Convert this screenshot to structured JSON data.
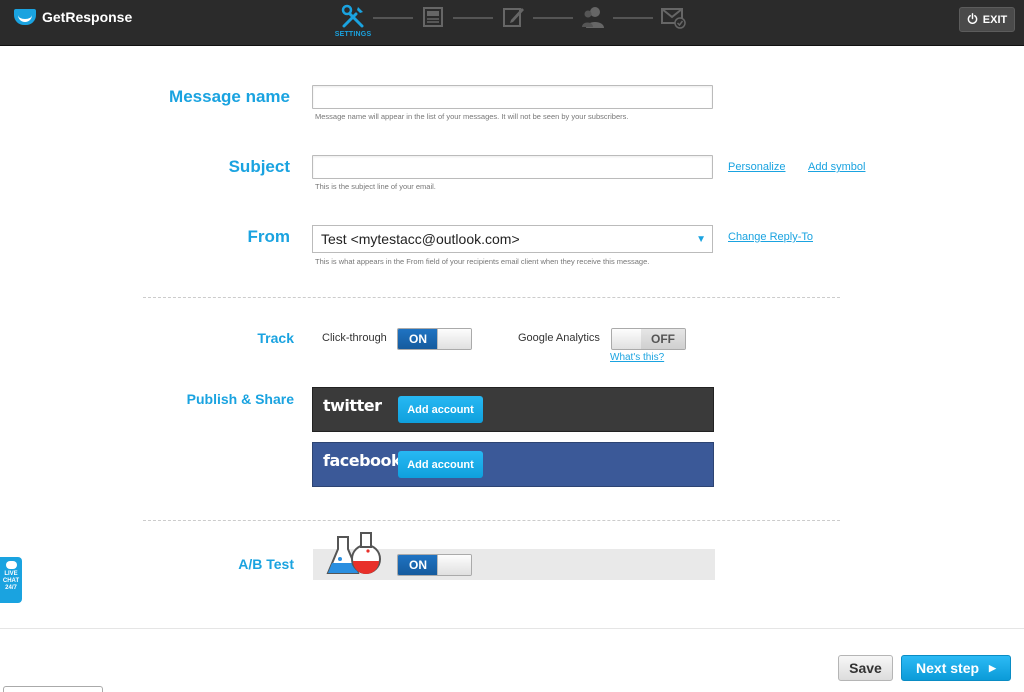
{
  "header": {
    "brand": "GetResponse",
    "steps": [
      {
        "icon": "tools-icon",
        "label": "SETTINGS",
        "active": true
      },
      {
        "icon": "template-icon",
        "label": "",
        "active": false
      },
      {
        "icon": "edit-icon",
        "label": "",
        "active": false
      },
      {
        "icon": "recipients-icon",
        "label": "",
        "active": false
      },
      {
        "icon": "send-check-icon",
        "label": "",
        "active": false
      }
    ],
    "exit_label": "EXIT"
  },
  "form": {
    "message_name": {
      "label": "Message name",
      "value": "",
      "hint": "Message name will appear in the list of your messages. It will not be seen by your subscribers."
    },
    "subject": {
      "label": "Subject",
      "value": "",
      "hint": "This is the subject line of your email.",
      "personalize_link": "Personalize",
      "add_symbol_link": "Add symbol"
    },
    "from": {
      "label": "From",
      "value": "Test <mytestacc@outlook.com>",
      "hint": "This is what appears in the From field of your recipients email client when they receive this message.",
      "change_reply_link": "Change Reply-To"
    },
    "track": {
      "label": "Track",
      "click_through_label": "Click-through",
      "click_through_state": "ON",
      "google_analytics_label": "Google Analytics",
      "google_analytics_state": "OFF",
      "whats_this_link": "What's this?"
    },
    "publish": {
      "label": "Publish & Share",
      "twitter_brand": "twitter",
      "twitter_button": "Add account",
      "facebook_brand": "facebook",
      "facebook_button": "Add account"
    },
    "ab_test": {
      "label": "A/B Test",
      "state": "ON"
    }
  },
  "footer": {
    "save_label": "Save",
    "next_label": "Next step"
  },
  "live_chat": {
    "line1": "LIVE",
    "line2": "CHAT",
    "line3": "24/7"
  },
  "colors": {
    "accent": "#1aa3e0",
    "topbar": "#2b2b2b",
    "toggle_on": "#1f73c2",
    "twitter_bg": "#3a3a3a",
    "facebook_bg": "#3b5998"
  }
}
